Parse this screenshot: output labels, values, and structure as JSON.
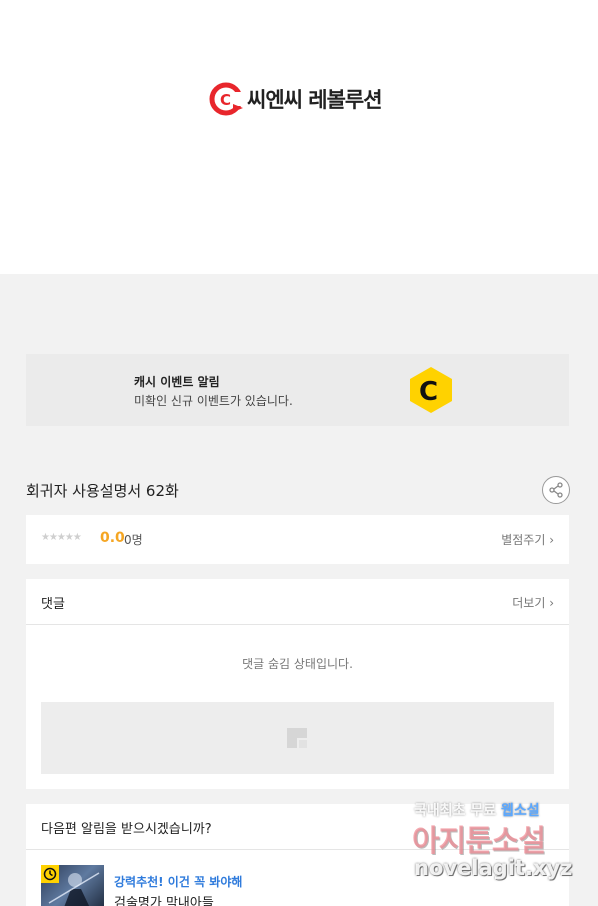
{
  "publisher": {
    "logo_text": "씨엔씨 레볼루션",
    "logo_color": "#e8262c"
  },
  "cash_event": {
    "title": "캐시 이벤트 알림",
    "subtitle": "미확인 신규 이벤트가 있습니다.",
    "icon": "c-coin-icon",
    "icon_color": "#ffd200"
  },
  "episode": {
    "title": "회귀자 사용설명서 62화",
    "share_icon": "share-icon"
  },
  "rating": {
    "stars": "★★★★★",
    "score": "0.0",
    "count": "0명",
    "rate_link": "별점주기 ›"
  },
  "comments": {
    "label": "댓글",
    "more_link": "더보기 ›",
    "hidden_message": "댓글 숨김 상태입니다."
  },
  "next_episode": {
    "label": "다음편 알림을 받으시겠습니까?",
    "recommend": {
      "tag": "강력추천! 이건 꼭 봐야해",
      "title": "검술명가 막내아들"
    }
  },
  "watermark": {
    "line1_prefix": "국내최초 무료 ",
    "line1_highlight": "웹소설",
    "line2": "아지툰소설",
    "line3": "novelagit.xyz"
  }
}
